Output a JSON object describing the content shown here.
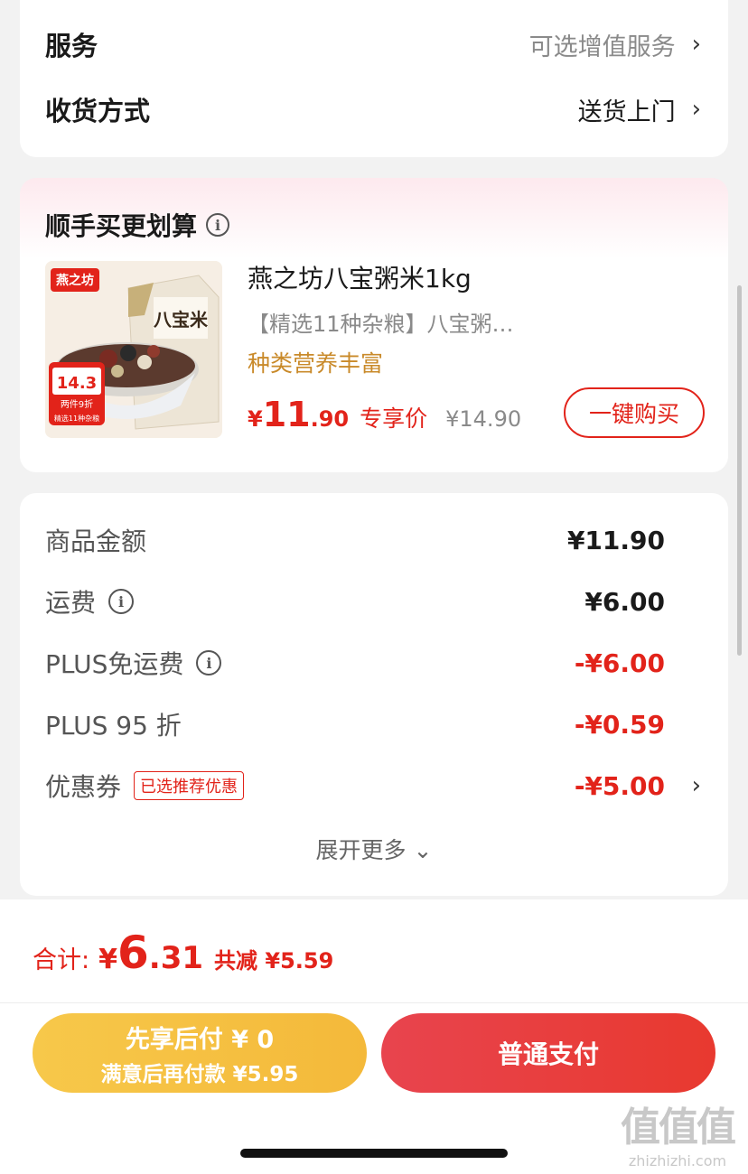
{
  "service_card": {
    "service_label": "服务",
    "service_value": "可选增值服务",
    "delivery_label": "收货方式",
    "delivery_value": "送货上门"
  },
  "addon": {
    "title": "顺手买更划算",
    "product": {
      "name": "燕之坊八宝粥米1kg",
      "desc": "【精选11种杂粮】八宝粥…",
      "tag": "种类营养丰富",
      "price_symbol": "¥",
      "price_int": "11",
      "price_dec": ".90",
      "price_label": "专享价",
      "original_price": "¥14.90",
      "buy_button": "一键购买",
      "image_brand": "燕之坊",
      "image_title": "八宝米",
      "image_price": "14.3",
      "image_promo": "两件9折",
      "image_footer": "精选11种杂粮"
    }
  },
  "fees": [
    {
      "label": "商品金额",
      "value": "¥11.90",
      "red": false,
      "info": false
    },
    {
      "label": "运费",
      "value": "¥6.00",
      "red": false,
      "info": true
    },
    {
      "label": "PLUS免运费",
      "value": "-¥6.00",
      "red": true,
      "info": true
    },
    {
      "label": "PLUS 95 折",
      "value": "-¥0.59",
      "red": true,
      "info": false
    },
    {
      "label": "优惠券",
      "value": "-¥5.00",
      "red": true,
      "info": false,
      "tag": "已选推荐优惠"
    }
  ],
  "expand_more": "展开更多 ⌄",
  "total": {
    "label": "合计:",
    "symbol": "¥",
    "int": "6",
    "dec": ".31",
    "saved": "共减 ¥5.59"
  },
  "buttons": {
    "pay_later_line1": "先享后付 ¥ 0",
    "pay_later_line2": "满意后再付款 ¥5.95",
    "pay_now": "普通支付"
  },
  "watermark": {
    "logo": "值值值",
    "site": "zhizhizhi.com"
  },
  "colors": {
    "accent_red": "#e2231a",
    "gold": "#f4b93a",
    "tag_orange": "#c98a2a"
  }
}
